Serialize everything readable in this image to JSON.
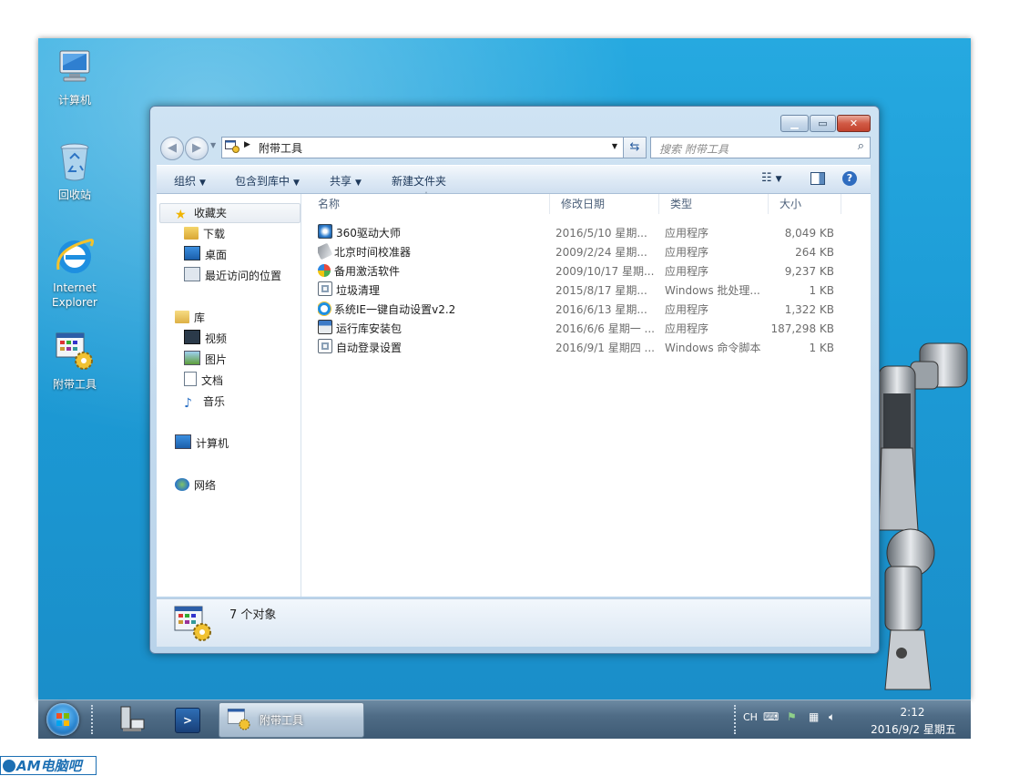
{
  "desktop": {
    "icons": [
      {
        "label": "计算机"
      },
      {
        "label": "回收站"
      },
      {
        "label_line1": "Internet",
        "label_line2": "Explorer"
      },
      {
        "label": "附带工具"
      }
    ]
  },
  "window": {
    "address_crumb": "附带工具",
    "search_placeholder": "搜索 附带工具",
    "toolbar": {
      "organize": "组织",
      "include_in_library": "包含到库中",
      "share": "共享",
      "new_folder": "新建文件夹"
    },
    "nav": {
      "favorites": "收藏夹",
      "downloads": "下载",
      "desktop": "桌面",
      "recent": "最近访问的位置",
      "libraries": "库",
      "videos": "视频",
      "pictures": "图片",
      "documents": "文档",
      "music": "音乐",
      "computer": "计算机",
      "network": "网络"
    },
    "columns": {
      "name": "名称",
      "date": "修改日期",
      "type": "类型",
      "size": "大小"
    },
    "files": [
      {
        "name": "360驱动大师",
        "date": "2016/5/10 星期...",
        "type": "应用程序",
        "size": "8,049 KB",
        "icon": "gear-app-icon"
      },
      {
        "name": "北京时间校准器",
        "date": "2009/2/24 星期...",
        "type": "应用程序",
        "size": "264 KB",
        "icon": "clock-app-icon"
      },
      {
        "name": "备用激活软件",
        "date": "2009/10/17 星期...",
        "type": "应用程序",
        "size": "9,237 KB",
        "icon": "windows-orb-icon"
      },
      {
        "name": "垃圾清理",
        "date": "2015/8/17 星期...",
        "type": "Windows 批处理...",
        "size": "1 KB",
        "icon": "batch-file-icon"
      },
      {
        "name": "系统IE一键自动设置v2.2",
        "date": "2016/6/13 星期...",
        "type": "应用程序",
        "size": "1,322 KB",
        "icon": "ie-icon"
      },
      {
        "name": "运行库安装包",
        "date": "2016/6/6 星期一 ...",
        "type": "应用程序",
        "size": "187,298 KB",
        "icon": "installer-icon"
      },
      {
        "name": "自动登录设置",
        "date": "2016/9/1 星期四 ...",
        "type": "Windows 命令脚本",
        "size": "1 KB",
        "icon": "script-file-icon"
      }
    ],
    "details": {
      "count_text": "7 个对象"
    }
  },
  "taskbar": {
    "active_task": "附带工具",
    "lang": "CH",
    "time": "2:12",
    "date": "2016/9/2 星期五"
  },
  "watermark": "AM电脑吧",
  "colors": {
    "desktop_blue": "#1c9bd6",
    "window_frame": "#b9d3ea",
    "close_red": "#c2422d",
    "toolbar_text": "#1e395b"
  }
}
